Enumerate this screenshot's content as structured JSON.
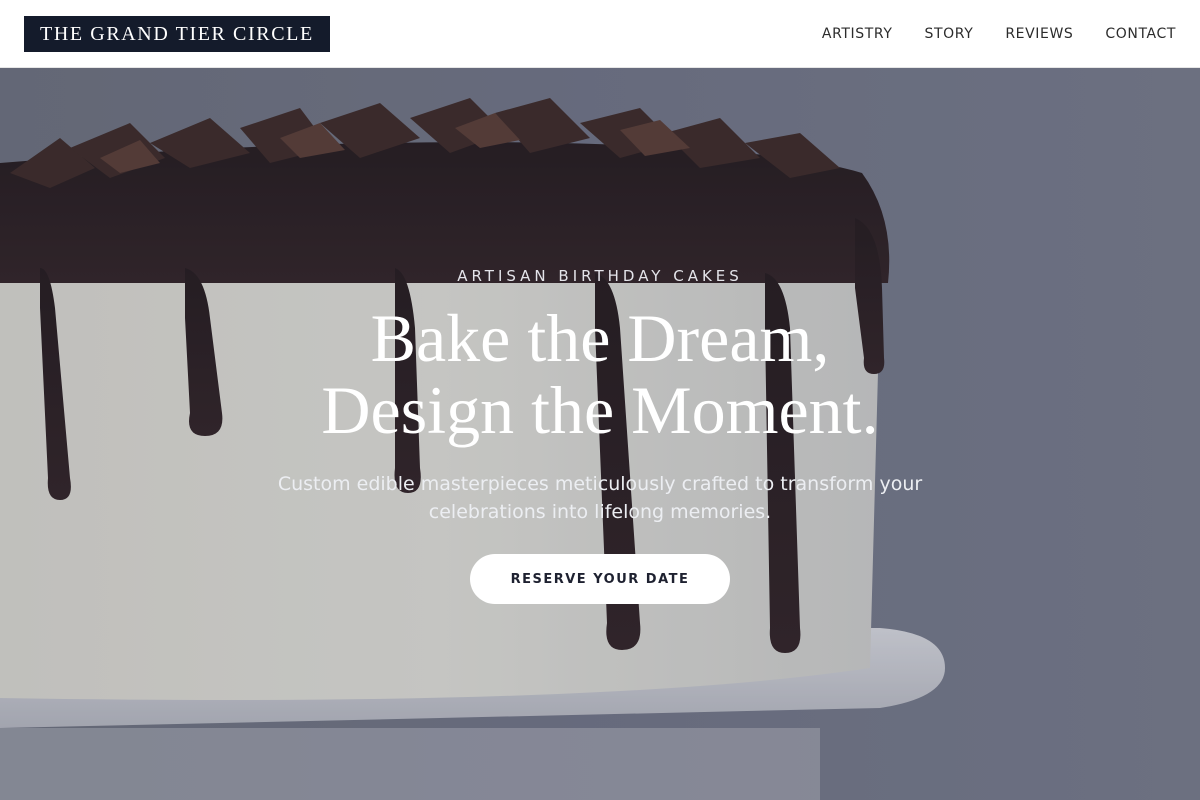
{
  "brand": {
    "name": "THE GRAND TIER CIRCLE"
  },
  "nav": {
    "items": [
      {
        "label": "ARTISTRY"
      },
      {
        "label": "STORY"
      },
      {
        "label": "REVIEWS"
      },
      {
        "label": "CONTACT"
      }
    ]
  },
  "hero": {
    "eyebrow": "ARTISAN BIRTHDAY CAKES",
    "headline_line1": "Bake the Dream,",
    "headline_line2": "Design the Moment.",
    "subtext": "Custom edible masterpieces meticulously crafted to transform your celebrations into lifelong memories.",
    "cta_label": "RESERVE YOUR DATE",
    "image": "chocolate-drip-cake-photo"
  },
  "colors": {
    "logo_background": "#141b2b",
    "hero_backdrop": "#74788a",
    "cake_frosting": "#e9e6dc",
    "chocolate_drip": "#241719",
    "cta_background": "#ffffff",
    "cta_text": "#1e2130"
  }
}
